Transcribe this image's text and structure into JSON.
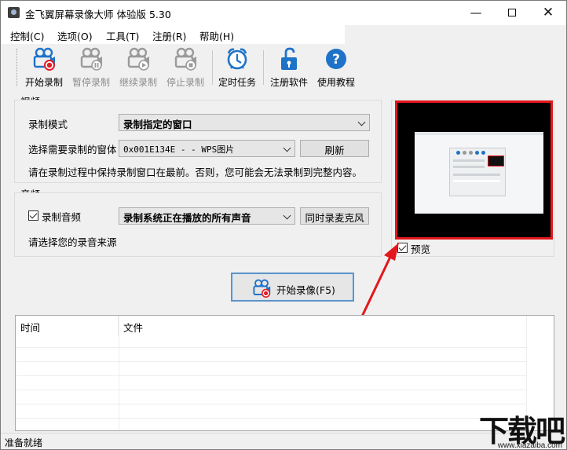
{
  "window": {
    "title": "金飞翼屏幕录像大师 体验版 5.30"
  },
  "menu": [
    "控制(C)",
    "选项(O)",
    "工具(T)",
    "注册(R)",
    "帮助(H)"
  ],
  "toolbar": {
    "start_record": "开始录制",
    "pause_record": "暂停录制",
    "resume_record": "继续录制",
    "stop_record": "停止录制",
    "scheduled_task": "定时任务",
    "register": "注册软件",
    "tutorial": "使用教程"
  },
  "video": {
    "title": "视频",
    "mode_label": "录制模式",
    "mode_value": "录制指定的窗口",
    "window_label": "选择需要录制的窗体",
    "window_value": "0x001E134E - - WPS图片",
    "refresh": "刷新",
    "hint": "请在录制过程中保持录制窗口在最前。否则，您可能会无法录制到完整内容。"
  },
  "audio": {
    "title": "音频",
    "record_label": "录制音频",
    "source_value": "录制系统正在播放的所有声音",
    "mic_button": "同时录麦克风",
    "hint": "请选择您的录音来源"
  },
  "preview": {
    "label": "预览",
    "checked": true
  },
  "start_button": "开始录像(F5)",
  "table": {
    "columns": [
      "时间",
      "文件"
    ]
  },
  "status": "准备就绪",
  "watermark": {
    "logo": "下载吧",
    "url": "www.xiazaiba.com"
  },
  "colors": {
    "highlight": "#e3161d",
    "accent": "#1e73c8",
    "record_dot": "#e31b23"
  },
  "icons": [
    "camera-record-icon",
    "camera-pause-icon",
    "camera-resume-icon",
    "camera-stop-icon",
    "alarm-clock-icon",
    "unlock-icon",
    "help-icon"
  ]
}
